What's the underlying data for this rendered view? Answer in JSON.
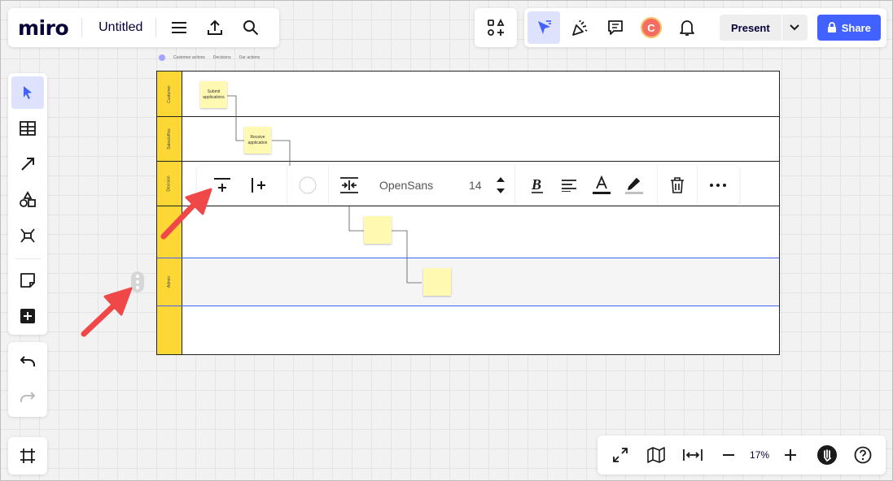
{
  "app": {
    "logo": "miro",
    "board_title": "Untitled"
  },
  "header": {
    "present_label": "Present",
    "share_label": "Share",
    "avatar_initial": "C"
  },
  "board": {
    "legend": [
      "Customer actions",
      "Decisions",
      "Our actions"
    ],
    "lanes": [
      "Customer",
      "Sales/office",
      "Decision",
      "",
      "Admin",
      ""
    ],
    "stickies": [
      {
        "text": "Submit applications"
      },
      {
        "text": "Receive application"
      },
      {
        "text": ""
      },
      {
        "text": ""
      }
    ]
  },
  "context_toolbar": {
    "font_name": "OpenSans",
    "font_size": "14",
    "text_color": "#1a1a1a",
    "highlight_color": "#c0c0c0"
  },
  "zoom": {
    "level": "17%"
  },
  "colors": {
    "accent": "#4262ff",
    "lane_label": "#fdd835",
    "sticky": "#fff9b1",
    "arrow": "#f04848"
  }
}
